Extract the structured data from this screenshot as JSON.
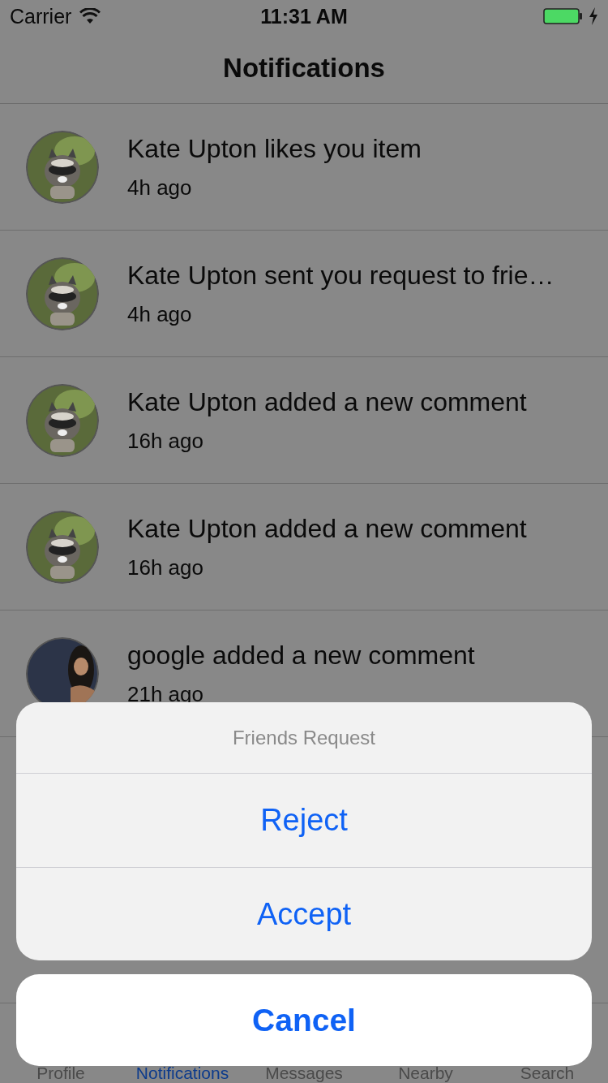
{
  "status_bar": {
    "carrier": "Carrier",
    "time": "11:31 AM"
  },
  "nav": {
    "title": "Notifications"
  },
  "notifications": [
    {
      "kind": "animal",
      "text": "Kate Upton likes you item",
      "time": "4h ago"
    },
    {
      "kind": "animal",
      "text": "Kate Upton sent you request to frie…",
      "time": "4h ago"
    },
    {
      "kind": "animal",
      "text": "Kate Upton added a new comment",
      "time": "16h ago"
    },
    {
      "kind": "animal",
      "text": "Kate Upton added a new comment",
      "time": "16h ago"
    },
    {
      "kind": "person",
      "text": "google added a new comment",
      "time": "21h ago"
    }
  ],
  "tabs": [
    {
      "label": "Profile",
      "selected": false
    },
    {
      "label": "Notifications",
      "selected": true
    },
    {
      "label": "Messages",
      "selected": false
    },
    {
      "label": "Nearby",
      "selected": false
    },
    {
      "label": "Search",
      "selected": false
    }
  ],
  "action_sheet": {
    "title": "Friends Request",
    "actions": [
      "Reject",
      "Accept"
    ],
    "cancel": "Cancel"
  }
}
